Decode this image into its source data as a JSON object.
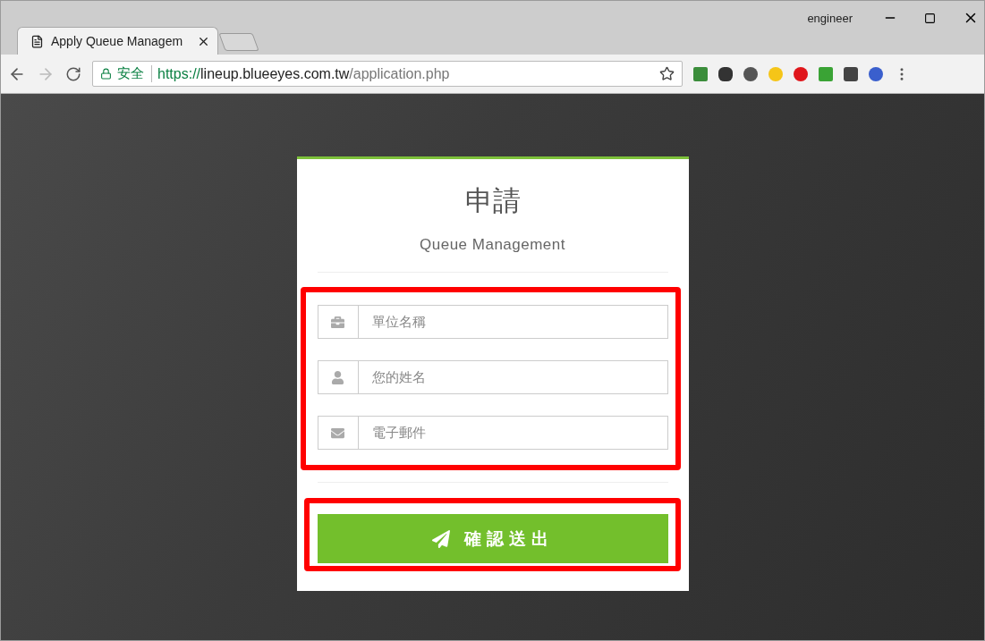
{
  "browser": {
    "tab_title": "Apply Queue Managem",
    "user": "engineer",
    "secure_label": "安全",
    "url_scheme": "https://",
    "url_host": "lineup.blueeyes.com.tw",
    "url_path": "/application.php"
  },
  "form": {
    "title": "申請",
    "subtitle": "Queue Management",
    "fields": [
      {
        "placeholder": "單位名稱"
      },
      {
        "placeholder": "您的姓名"
      },
      {
        "placeholder": "電子郵件"
      }
    ],
    "submit": "確認送出"
  }
}
